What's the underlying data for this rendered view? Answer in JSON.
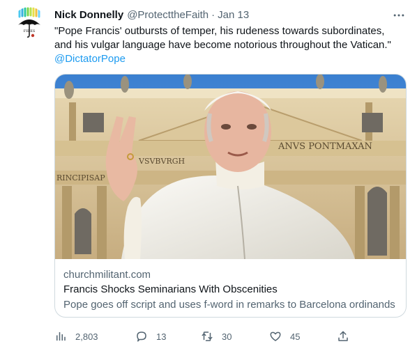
{
  "tweet": {
    "author_name": "Nick Donnelly",
    "author_handle": "@ProtecttheFaith",
    "separator": "·",
    "timestamp": "Jan 13",
    "text_line1": "\"Pope Francis' outbursts of temper, his rudeness towards subordinates,",
    "text_line2": "and his vulgar language have become notorious throughout the Vatican.\"",
    "mention": "@DictatorPope",
    "avatar_text": "FIDES"
  },
  "card": {
    "domain": "churchmilitant.com",
    "title": "Francis Shocks Seminarians With Obscenities",
    "description": "Pope goes off script and uses f-word in remarks to Barcelona ordinands",
    "image_inscription_right": "ANVS PONTMAXAN",
    "image_inscription_mid": "VSVBVRGH",
    "image_inscription_left": "RINCIPISAP"
  },
  "actions": {
    "views_count": "2,803",
    "replies_count": "13",
    "retweets_count": "30",
    "likes_count": "45"
  },
  "icons": {
    "more": "more-dots-icon",
    "views": "analytics-bars-icon",
    "reply": "reply-bubble-icon",
    "retweet": "retweet-arrows-icon",
    "like": "heart-icon",
    "share": "share-upload-icon"
  },
  "colors": {
    "text_primary": "#0f1419",
    "text_secondary": "#536471",
    "link": "#1d9bf0",
    "border": "#cfd9de"
  }
}
